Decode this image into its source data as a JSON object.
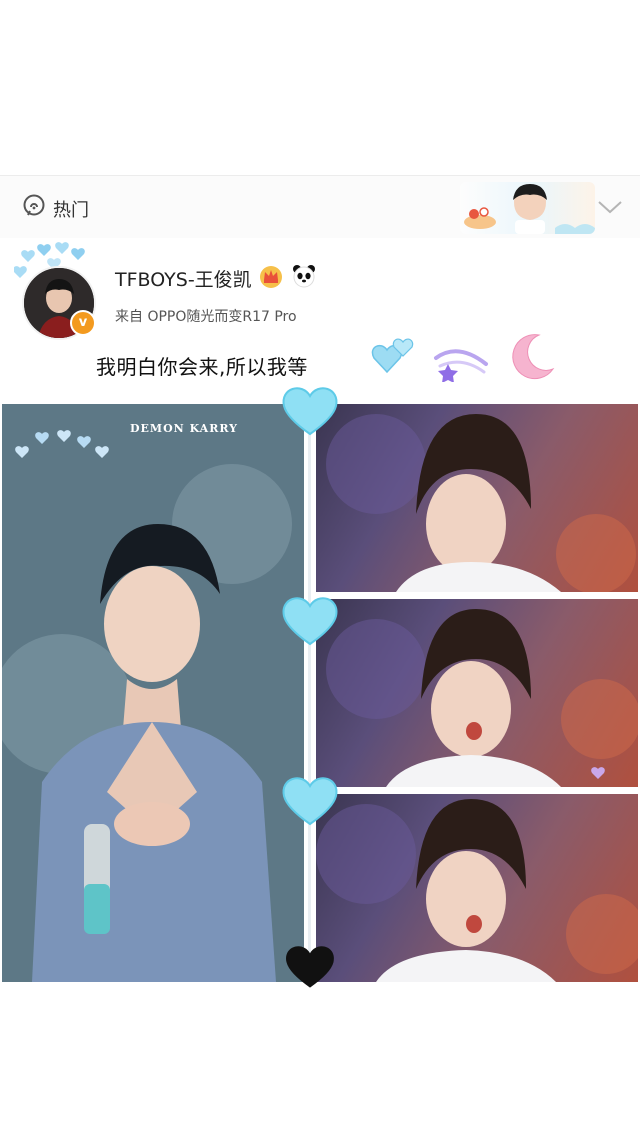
{
  "header": {
    "hot_label": "热门"
  },
  "post": {
    "user_name": "TFBOYS-王俊凯",
    "source": "来自 OPPO随光而变R17 Pro",
    "text": "我明白你会来,所以我等",
    "verified_mark": "v"
  },
  "photos": {
    "left_watermark": "DEMON KARRY"
  },
  "colors": {
    "verified_badge": "#f39a1f",
    "heart_blue": "#7fd3f0",
    "heart_black": "#111111",
    "moon_pink": "#f4a6c6"
  },
  "icons": {
    "hot": "hot-topic-icon",
    "crown": "crown-icon",
    "panda": "panda-icon",
    "chevron": "chevron-down-icon"
  }
}
